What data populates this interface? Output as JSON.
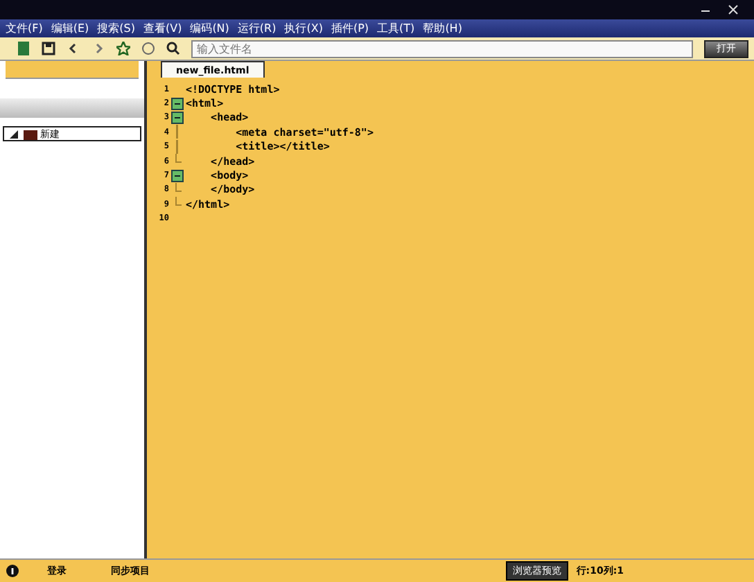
{
  "menu": [
    "文件(F)",
    "编辑(E)",
    "搜索(S)",
    "查看(V)",
    "编码(N)",
    "运行(R)",
    "执行(X)",
    "插件(P)",
    "工具(T)",
    "帮助(H)"
  ],
  "toolbar": {
    "placeholder": "输入文件名",
    "go_button": "打开"
  },
  "sidebar": {
    "tree": [
      {
        "label": "新建",
        "expanded": true,
        "selected": true
      }
    ]
  },
  "tab": {
    "label": "new_file.html",
    "selected": true
  },
  "code": [
    {
      "n": "1",
      "kind": "plain",
      "text": "<!DOCTYPE html>"
    },
    {
      "n": "2",
      "kind": "fold",
      "text": "<html>"
    },
    {
      "n": "3",
      "kind": "fold",
      "text": "    <head>"
    },
    {
      "n": "4",
      "kind": "inner",
      "text": "        <meta charset=\"utf-8\">"
    },
    {
      "n": "5",
      "kind": "inner",
      "text": "        <title></title>"
    },
    {
      "n": "6",
      "kind": "end",
      "text": "    </head>"
    },
    {
      "n": "7",
      "kind": "fold",
      "text": "    <body>"
    },
    {
      "n": "8",
      "kind": "end",
      "text": "    </body>"
    },
    {
      "n": "9",
      "kind": "end",
      "text": "</html>"
    },
    {
      "n": "10",
      "kind": "plain"
    }
  ],
  "status_bar": {
    "login": "登录",
    "sync": "同步项目",
    "preview_button": "浏览器预览",
    "position": "行:10列:1"
  }
}
